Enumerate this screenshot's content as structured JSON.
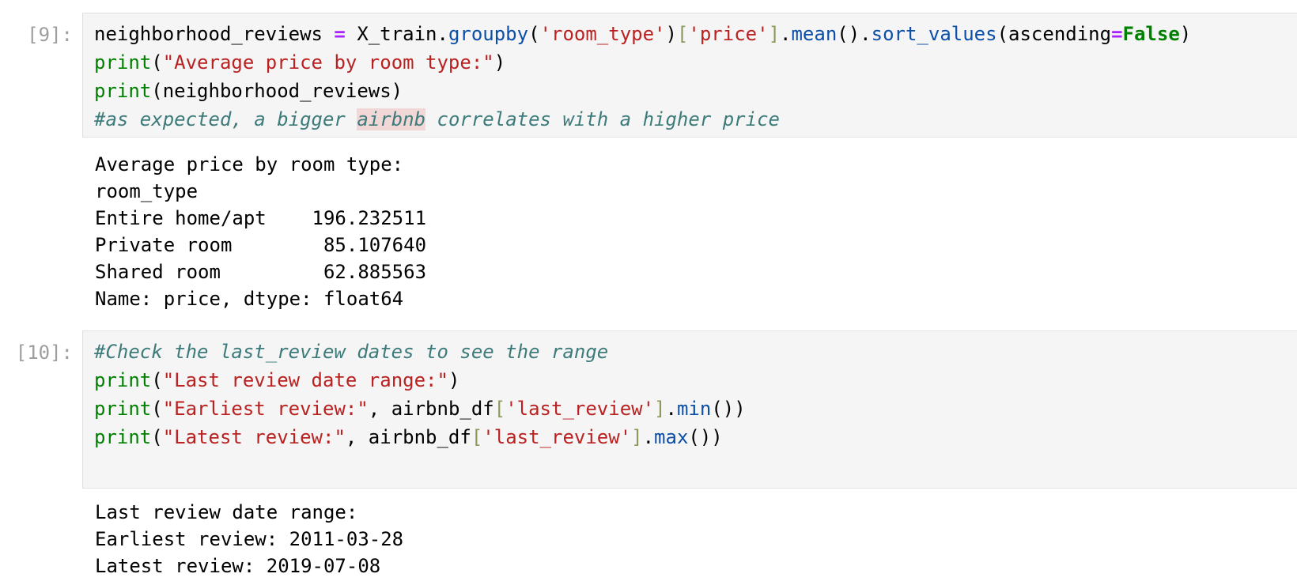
{
  "cells": [
    {
      "prompt": "[9]:",
      "code": {
        "line1": {
          "var": "neighborhood_reviews",
          "eq": " = ",
          "obj": "X_train.",
          "m_groupby": "groupby",
          "p1": "(",
          "s_roomtype": "'room_type'",
          "p2": ")",
          "b_open": "[",
          "s_price": "'price'",
          "b_close": "]",
          "dot1": ".",
          "m_mean": "mean",
          "p3": "().",
          "m_sort": "sort_values",
          "p4": "(ascending",
          "eq2": "=",
          "kw_false": "False",
          "p5": ")"
        },
        "line2": {
          "fn": "print",
          "open": "(",
          "str": "\"Average price by room type:\"",
          "close": ")"
        },
        "line3": {
          "fn": "print",
          "rest": "(neighborhood_reviews)"
        },
        "line4": {
          "c1": "#as expected, a bigger ",
          "c_hl": "airbnb",
          "c2": " correlates with a higher price"
        }
      },
      "output": [
        "Average price by room type:",
        "room_type",
        "Entire home/apt    196.232511",
        "Private room        85.107640",
        "Shared room         62.885563",
        "Name: price, dtype: float64"
      ]
    },
    {
      "prompt": "[10]:",
      "code": {
        "line1": {
          "comment": "#Check the last_review dates to see the range"
        },
        "line2": {
          "fn": "print",
          "open": "(",
          "str": "\"Last review date range:\"",
          "close": ")"
        },
        "line3": {
          "fn": "print",
          "open": "(",
          "str": "\"Earliest review:\"",
          "mid": ", airbnb_df",
          "b_open": "[",
          "s_key": "'last_review'",
          "b_close": "]",
          "dot": ".",
          "method": "min",
          "close": "())"
        },
        "line4": {
          "fn": "print",
          "open": "(",
          "str": "\"Latest review:\"",
          "mid": ", airbnb_df",
          "b_open": "[",
          "s_key": "'last_review'",
          "b_close": "]",
          "dot": ".",
          "method": "max",
          "close": "())"
        }
      },
      "output": [
        "Last review date range:",
        "Earliest review: 2011-03-28",
        "Latest review: 2019-07-08"
      ]
    }
  ]
}
